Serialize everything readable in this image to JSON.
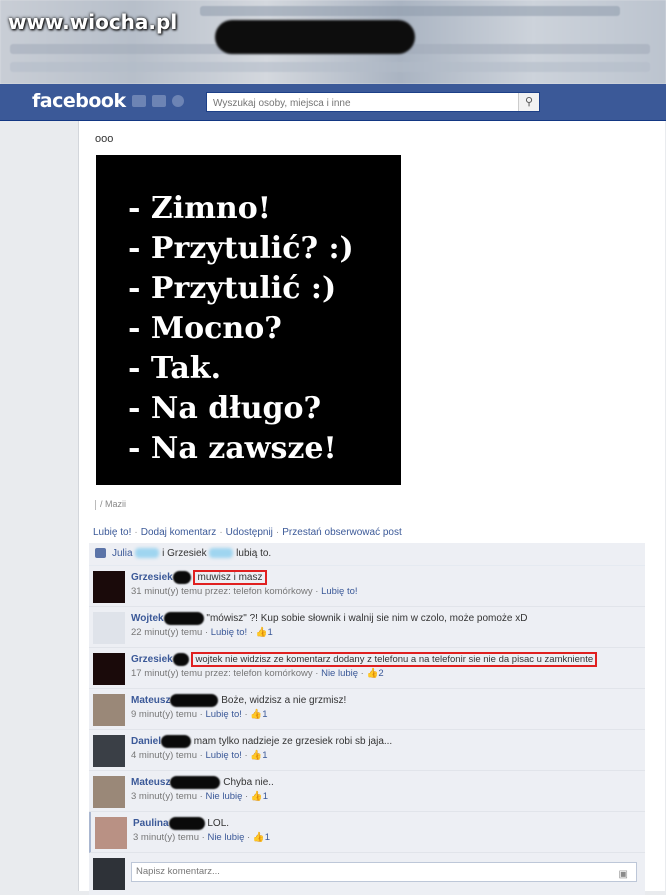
{
  "watermark": "www.wiocha.pl",
  "header": {
    "logo": "facebook",
    "search_placeholder": "Wyszukaj osoby, miejsca i inne",
    "search_icon": "search-icon"
  },
  "post": {
    "text": "ooo",
    "image_lines": [
      "- Zimno!",
      "- Przytulić? :)",
      "- Przytulić :)",
      "- Mocno?",
      "- Tak.",
      "- Na długo?",
      "- Na zawsze!"
    ],
    "via": "/ Mazii",
    "actions": [
      "Lubię to!",
      "Dodaj komentarz",
      "Udostępnij",
      "Przestań obserwować post"
    ]
  },
  "likes": {
    "name1": "Julia",
    "conj": "i Grzesiek",
    "suffix": "lubią to."
  },
  "comments": [
    {
      "name": "Grzesiek",
      "text": "muwisz i masz",
      "time": "31 minut(y) temu przez: telefon komórkowy",
      "action": "Lubię to!",
      "count": ""
    },
    {
      "name": "Wojtek",
      "text": "\"mówisz\" ?! Kup sobie słownik i walnij sie nim w czolo, może pomoże xD",
      "time": "22 minut(y) temu",
      "action": "Lubię to!",
      "count": "1"
    },
    {
      "name": "Grzesiek",
      "text": "wojtek nie widzisz ze komentarz dodany z telefonu a na telefonir sie nie da pisac u zamkniente",
      "time": "17 minut(y) temu przez: telefon komórkowy",
      "action": "Nie lubię",
      "count": "2"
    },
    {
      "name": "Mateusz",
      "text": "Boże, widzisz a nie grzmisz!",
      "time": "9 minut(y) temu",
      "action": "Lubię to!",
      "count": "1"
    },
    {
      "name": "Daniel",
      "text": "mam tylko nadzieje ze grzesiek robi sb jaja...",
      "time": "4 minut(y) temu",
      "action": "Lubię to!",
      "count": "1"
    },
    {
      "name": "Mateusz",
      "text": "Chyba nie..",
      "time": "3 minut(y) temu",
      "action": "Nie lubię",
      "count": "1"
    },
    {
      "name": "Paulina",
      "text": "LOL.",
      "time": "3 minut(y) temu",
      "action": "Nie lubię",
      "count": "1"
    }
  ],
  "write_comment": {
    "placeholder": "Napisz komentarz...",
    "camera_icon": "camera-icon"
  }
}
